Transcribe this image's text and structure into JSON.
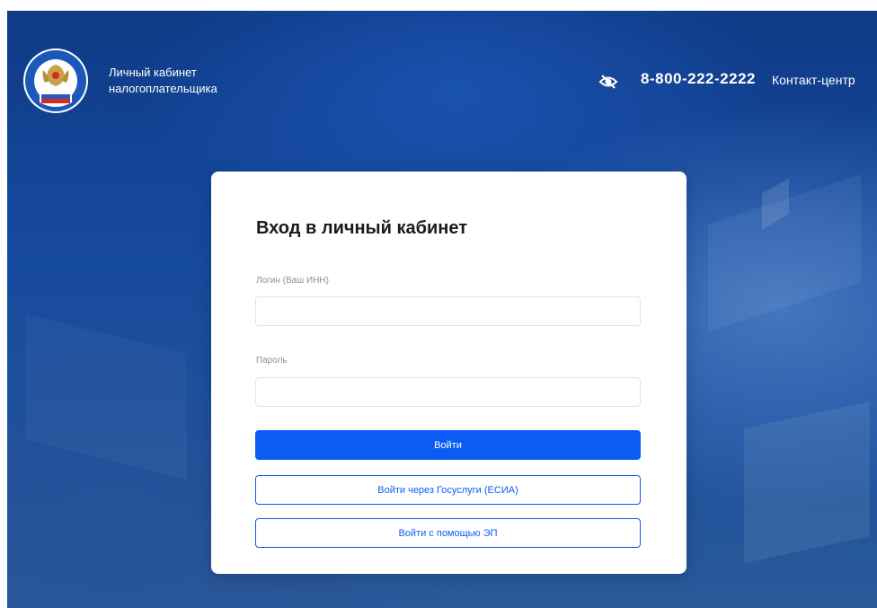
{
  "header": {
    "brand_line1": "Личный кабинет",
    "brand_line2": "налогоплательщика",
    "phone": "8-800-222-2222",
    "contact_center": "Контакт-центр",
    "accessibility_icon": "eye-low-vision-icon",
    "emblem_icon": "fns-emblem-icon"
  },
  "login_form": {
    "title": "Вход в личный кабинет",
    "login_label": "Логин (Ваш ИНН)",
    "login_value": "",
    "password_label": "Пароль",
    "password_value": "",
    "submit_label": "Войти",
    "esia_label": "Войти через Госуслуги (ЕСИА)",
    "ep_label": "Войти с помощью ЭП"
  },
  "colors": {
    "primary": "#0a5cf5",
    "background_top": "#0f3a86",
    "background_bottom": "#2a5a9a",
    "card": "#ffffff"
  }
}
